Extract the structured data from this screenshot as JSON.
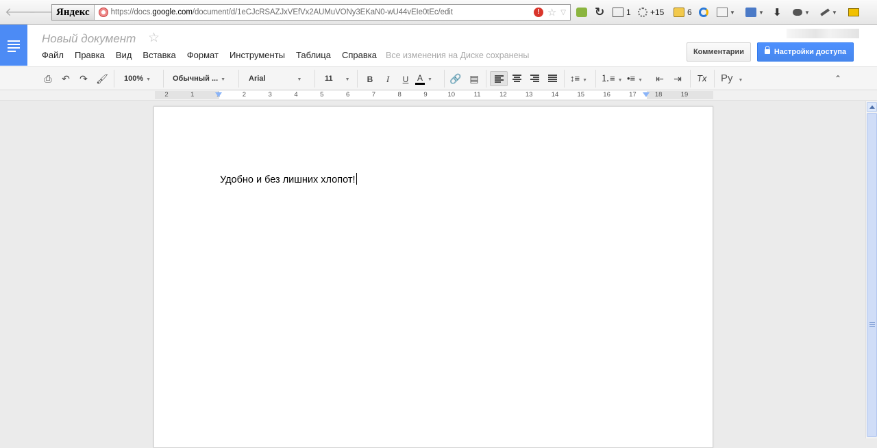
{
  "browser": {
    "back_glyph": "🡐",
    "forward_glyph": "🡒",
    "search_provider": "Яндекс",
    "url_prefix": "https://docs.",
    "url_host": "google.com",
    "url_path": "/document/d/1eCJcRSAZJxVEfVx2AUMuVONy3EKaN0-wU44vEIe0tEc/edit",
    "mail_count": "1",
    "weather_temp": "+15",
    "notes_count": "6"
  },
  "header": {
    "doc_title": "Новый документ",
    "saved_status": "Все изменения на Диске сохранены",
    "comments_label": "Комментарии",
    "share_label": "Настройки доступа",
    "brand_color": "#4c8bf5",
    "share_color": "#4d90fe"
  },
  "menu": {
    "items": [
      "Файл",
      "Правка",
      "Вид",
      "Вставка",
      "Формат",
      "Инструменты",
      "Таблица",
      "Справка"
    ]
  },
  "toolbar": {
    "zoom": "100%",
    "paragraph_style": "Обычный ...",
    "font": "Arial",
    "font_size": "11",
    "bold": "B",
    "italic": "I",
    "underline": "U",
    "text_color": "A",
    "input_language": "Ру",
    "clear_format": "Tx"
  },
  "ruler": {
    "ticks": [
      "2",
      "1",
      "1",
      "2",
      "3",
      "4",
      "5",
      "6",
      "7",
      "8",
      "9",
      "10",
      "11",
      "12",
      "13",
      "14",
      "15",
      "16",
      "17",
      "18",
      "19"
    ]
  },
  "document": {
    "text": "Удобно и без лишних хлопот!"
  }
}
